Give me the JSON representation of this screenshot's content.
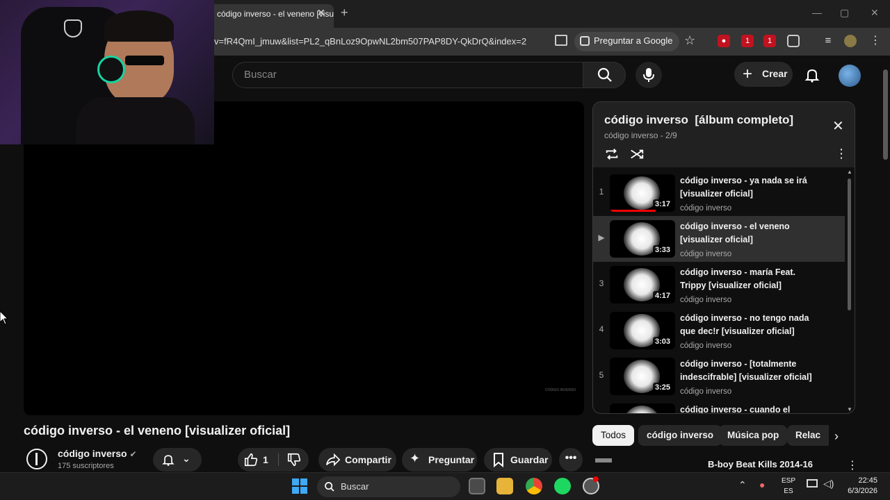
{
  "browser": {
    "tab_title": "código inverso - el veneno [visualizer oficial]",
    "url": "v=fR4QmI_jmuw&list=PL2_qBnLoz9OpwNL2bm507PAP8DY-QkDrQ&index=2",
    "ask_google": "Preguntar a Google"
  },
  "header": {
    "search_placeholder": "Buscar",
    "create_label": "Crear"
  },
  "video": {
    "title": "código inverso - el veneno [visualizer oficial]",
    "watermark": "CODIGO INVERSO",
    "channel_name": "código inverso",
    "subscribers": "175 suscriptores",
    "like_count": "1",
    "share_label": "Compartir",
    "ask_label": "Preguntar",
    "save_label": "Guardar"
  },
  "playlist": {
    "title": "código inverso  [álbum completo]",
    "subtitle": "código inverso - 2/9",
    "items": [
      {
        "index": "1",
        "title": "código inverso - ya nada se irá [visualizer oficial]",
        "channel": "código inverso",
        "duration": "3:17",
        "progress": 0.7
      },
      {
        "index": "▶",
        "title": "código inverso - el veneno [visualizer oficial]",
        "channel": "código inverso",
        "duration": "3:33",
        "active": true
      },
      {
        "index": "3",
        "title": "código inverso - maría Feat. Trippy [visualizer oficial]",
        "channel": "código inverso",
        "duration": "4:17"
      },
      {
        "index": "4",
        "title": "código inverso - no tengo nada que dec!r [visualizer oficial]",
        "channel": "código inverso",
        "duration": "3:03"
      },
      {
        "index": "5",
        "title": "código inverso - [totalmente indescifrable] [visualizer oficial]",
        "channel": "código inverso",
        "duration": "3:25"
      },
      {
        "index": "",
        "title": "código inverso - cuando el",
        "channel": "",
        "duration": ""
      }
    ]
  },
  "chips": [
    "Todos",
    "código inverso",
    "Música pop",
    "Relac"
  ],
  "next_video": {
    "title": "B-boy Beat Kills 2014-16"
  },
  "taskbar": {
    "search_label": "Buscar",
    "lang_top": "ESP",
    "lang_bottom": "ES",
    "time": "22:45",
    "date": "6/3/2026"
  },
  "colors": {
    "accent_red": "#ff0000",
    "bg": "#0f0f0f",
    "surface": "#272727"
  }
}
